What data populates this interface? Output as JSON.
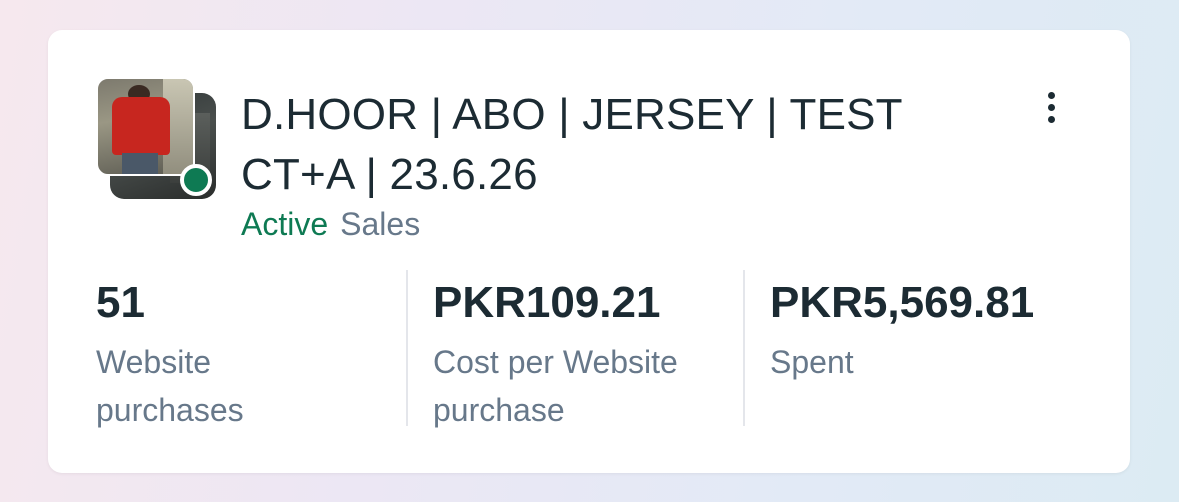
{
  "campaign": {
    "title": "D.HOOR | ABO | JERSEY | TEST CT+A | 23.6.26",
    "status": "Active",
    "objective": "Sales",
    "status_color": "#0e7a53"
  },
  "metrics": [
    {
      "value": "51",
      "label": "Website purchases"
    },
    {
      "value": "PKR109.21",
      "label": "Cost per Website purchase"
    },
    {
      "value": "PKR5,569.81",
      "label": "Spent"
    }
  ],
  "icons": {
    "more": "more-vertical-icon"
  }
}
